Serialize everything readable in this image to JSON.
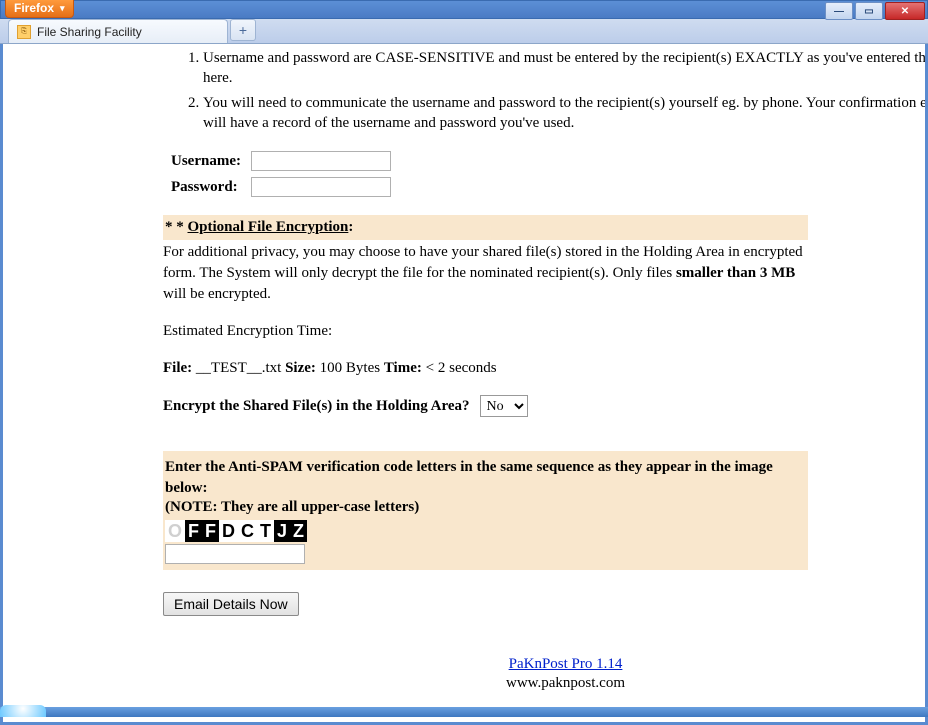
{
  "titlebar": {
    "firefox_label": "Firefox"
  },
  "tab": {
    "title": "File Sharing Facility"
  },
  "instructions": {
    "item1": "Username and password are CASE-SENSITIVE and must be entered by the recipient(s) EXACTLY as you've entered them here.",
    "item2": "You will need to communicate the username and password to the recipient(s) yourself eg. by phone. Your confirmation email will have a record of the username and password you've used."
  },
  "cred": {
    "username_label": "Username:",
    "password_label": "Password:",
    "username_value": "",
    "password_value": ""
  },
  "encryption": {
    "stars": "* *",
    "heading_u": "Optional File Encryption",
    "colon": ":",
    "desc_pre": "For additional privacy, you may choose to have your shared file(s) stored in the Holding Area in encrypted form. The System will only decrypt the file for the nominated recipient(s). Only files ",
    "desc_bold": "smaller than 3 MB",
    "desc_post": " will be encrypted.",
    "est_label": "Estimated Encryption Time:",
    "file_label": "File:",
    "file_value": "__TEST__.txt",
    "size_label": "Size:",
    "size_value": "100 Bytes",
    "time_label": "Time:",
    "time_value": "< 2 seconds",
    "question": "Encrypt the Shared File(s) in the Holding Area?",
    "select_value": "No"
  },
  "antispam": {
    "header": "Enter the Anti-SPAM verification code letters in the same sequence as they appear in the image below:",
    "note": "(NOTE: They are all upper-case letters)",
    "chars": [
      {
        "c": "O",
        "style": "o"
      },
      {
        "c": "F",
        "style": "b"
      },
      {
        "c": "F",
        "style": "b"
      },
      {
        "c": "D",
        "style": "w"
      },
      {
        "c": "C",
        "style": "w"
      },
      {
        "c": "T",
        "style": "w"
      },
      {
        "c": "J",
        "style": "b"
      },
      {
        "c": "Z",
        "style": "b"
      }
    ],
    "input_value": ""
  },
  "submit": {
    "label": "Email Details Now"
  },
  "footer": {
    "link_text": "PaKnPost Pro 1.14",
    "site": "www.paknpost.com"
  }
}
